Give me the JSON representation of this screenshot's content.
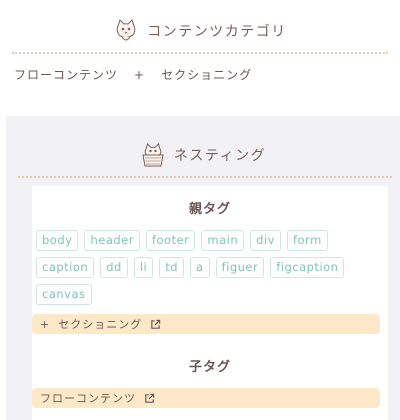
{
  "content_category": {
    "title": "コンテンツカテゴリ",
    "items": [
      "フローコンテンツ",
      "+",
      "セクショニング"
    ]
  },
  "nesting": {
    "title": "ネスティング",
    "parent": {
      "title": "親タグ",
      "tags": [
        "body",
        "header",
        "footer",
        "main",
        "div",
        "form",
        "caption",
        "dd",
        "li",
        "td",
        "a",
        "figuer",
        "figcaption",
        "canvas"
      ],
      "link_prefix": "+",
      "link_label": "セクショニング"
    },
    "child": {
      "title": "子タグ",
      "link_label": "フローコンテンツ"
    }
  },
  "colors": {
    "accent_tag": "#7fc4b6",
    "link_bar": "#fde8c8",
    "panel_bg": "#f1f1f6",
    "text": "#6b5552"
  },
  "icons": [
    "cat-icon",
    "cat-basket-icon",
    "external-link-icon"
  ]
}
